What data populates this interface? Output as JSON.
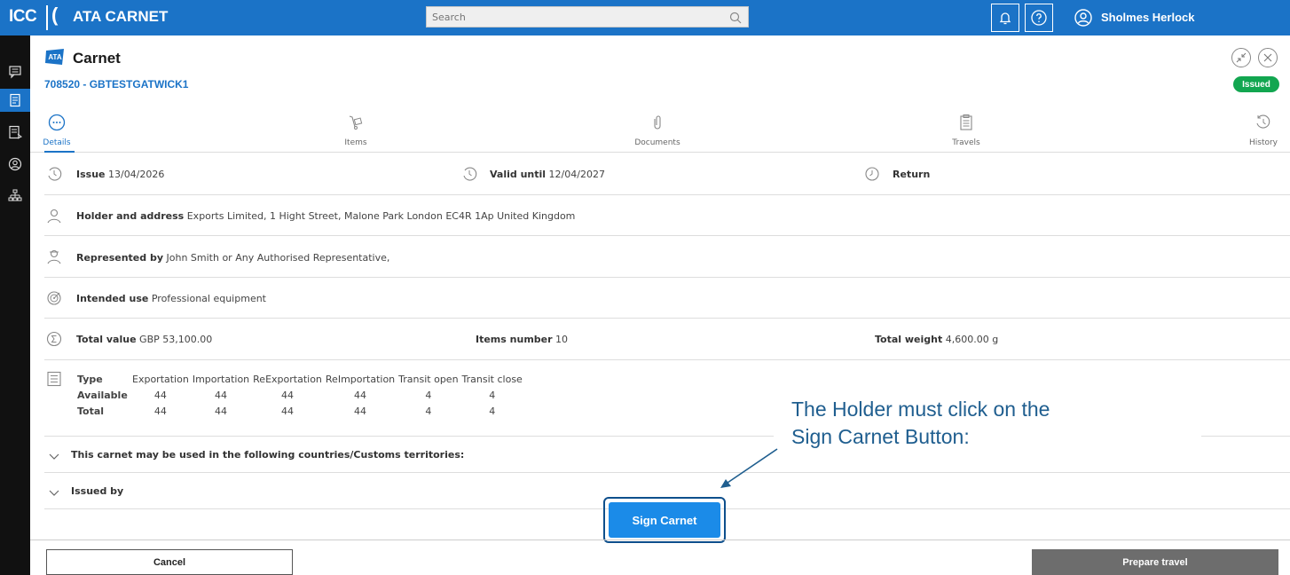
{
  "topbar": {
    "logo_icc": "ICC",
    "logo_paren": "(",
    "app_name": "ATA CARNET",
    "search_placeholder": "Search",
    "user_name": "Sholmes Herlock"
  },
  "header": {
    "title": "Carnet",
    "ata_badge": "ATA",
    "carnet_id": "708520 - GBTESTGATWICK1",
    "status": "Issued",
    "status_color": "#12a650"
  },
  "tabs": [
    {
      "label": "Details",
      "icon": "dots-circle-icon",
      "active": true
    },
    {
      "label": "Items",
      "icon": "hand-truck-icon"
    },
    {
      "label": "Documents",
      "icon": "paperclip-icon"
    },
    {
      "label": "Travels",
      "icon": "clipboard-icon"
    },
    {
      "label": "History",
      "icon": "history-icon"
    }
  ],
  "dates": {
    "issue_label": "Issue",
    "issue_value": "13/04/2026",
    "valid_label": "Valid until",
    "valid_value": "12/04/2027",
    "return_label": "Return"
  },
  "holder": {
    "label": "Holder and address",
    "value": "Exports Limited, 1 Hight Street, Malone Park London EC4R 1Ap United Kingdom"
  },
  "represented": {
    "label": "Represented by",
    "value": "John Smith or Any Authorised Representative,"
  },
  "intended": {
    "label": "Intended use",
    "value": "Professional equipment"
  },
  "totals": {
    "value_label": "Total value",
    "value_value": "GBP 53,100.00",
    "items_label": "Items number",
    "items_value": "10",
    "weight_label": "Total weight",
    "weight_value": "4,600.00 g"
  },
  "counterfoils": {
    "header_label": "Type",
    "columns": [
      "Exportation",
      "Importation",
      "ReExportation",
      "ReImportation",
      "Transit open",
      "Transit close"
    ],
    "rows": [
      {
        "label": "Available",
        "values": [
          "44",
          "44",
          "44",
          "44",
          "4",
          "4"
        ]
      },
      {
        "label": "Total",
        "values": [
          "44",
          "44",
          "44",
          "44",
          "4",
          "4"
        ]
      }
    ]
  },
  "accordions": {
    "countries": "This carnet may be used in the following countries/Customs territories:",
    "issued_by": "Issued by"
  },
  "actions": {
    "sign": "Sign Carnet",
    "cancel": "Cancel",
    "prepare": "Prepare travel"
  },
  "annotation": {
    "line1": "The Holder must click on the",
    "line2": "Sign Carnet Button:"
  },
  "colors": {
    "brand": "#1b73c7",
    "rail": "#111111",
    "sign_button": "#1b8be8",
    "prepare_button": "#6d6d6d"
  }
}
